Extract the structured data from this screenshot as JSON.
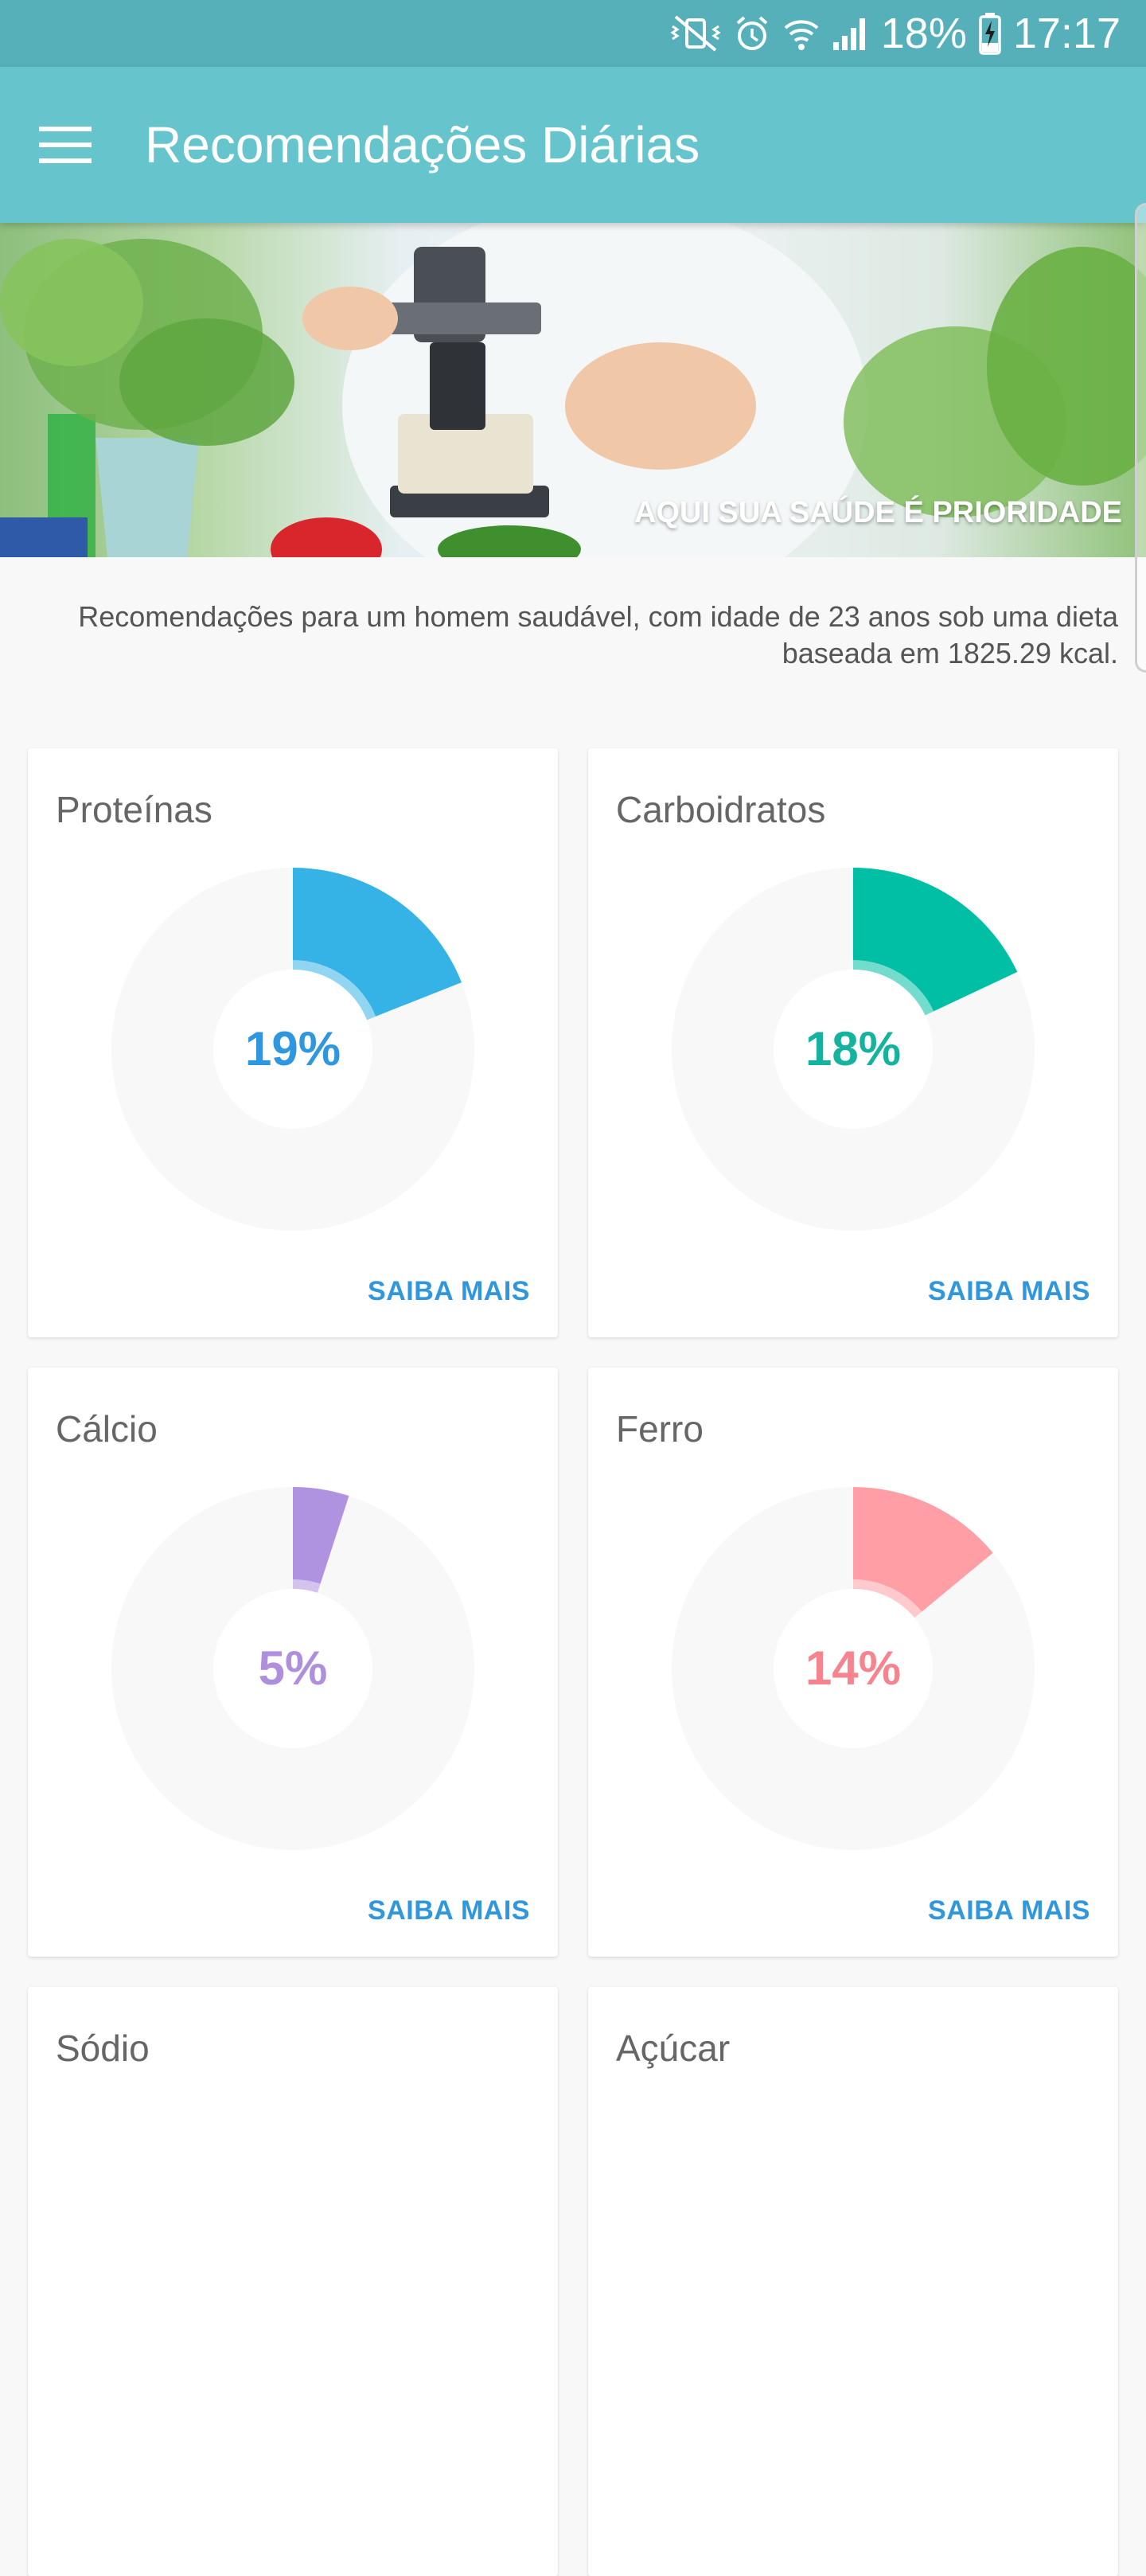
{
  "status_bar": {
    "battery": "18%",
    "time": "17:17",
    "icons": [
      "vibrate-mute-icon",
      "alarm-icon",
      "wifi-icon",
      "signal-icon",
      "battery-charging-icon"
    ]
  },
  "app_bar": {
    "menu_icon": "hamburger-menu-icon",
    "title": "Recomendações Diárias"
  },
  "hero": {
    "tagline": "AQUI SUA SAÚDE É PRIORIDADE"
  },
  "intro_text": "Recomendações para um homem saudável, com idade de 23 anos sob uma dieta baseada em 1825.29 kcal.",
  "cards": [
    {
      "title": "Proteínas",
      "percent_label": "19%",
      "percent": 19,
      "color": "#35b2e6",
      "text_color": "#2f96e0",
      "link": "SAIBA MAIS"
    },
    {
      "title": "Carboidratos",
      "percent_label": "18%",
      "percent": 18,
      "color": "#00bfa5",
      "text_color": "#13b3a0",
      "link": "SAIBA MAIS"
    },
    {
      "title": "Cálcio",
      "percent_label": "5%",
      "percent": 5,
      "color": "#b093e0",
      "text_color": "#ae8fde",
      "link": "SAIBA MAIS"
    },
    {
      "title": "Ferro",
      "percent_label": "14%",
      "percent": 14,
      "color": "#ff9ea5",
      "text_color": "#f6848e",
      "link": "SAIBA MAIS"
    },
    {
      "title": "Sódio",
      "partial": true
    },
    {
      "title": "Açúcar",
      "partial": true
    }
  ]
}
